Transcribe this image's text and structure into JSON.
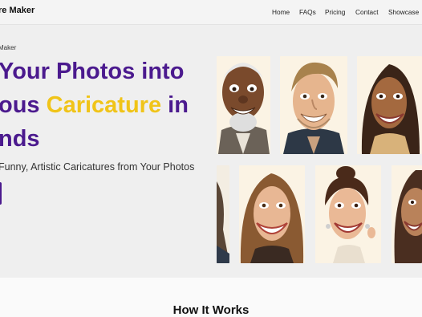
{
  "header": {
    "brand": "re Maker",
    "nav": [
      "Home",
      "FAQs",
      "Pricing",
      "Contact",
      "Showcase"
    ]
  },
  "hero": {
    "eyebrow": "Maker",
    "title_line1": "Your Photos into",
    "title_line2_pre": "ous ",
    "title_line2_accent": "Caricature",
    "title_line2_post": " in",
    "title_line3": "nds",
    "subtitle": "Funny, Artistic Caricatures from Your Photos"
  },
  "gallery": {
    "images": [
      "caricature-elderly-man",
      "caricature-smiling-man",
      "caricature-woman-long-hair",
      "caricature-partial-left",
      "caricature-woman-wavy-hair",
      "caricature-woman-updo-earrings",
      "caricature-partial-right"
    ]
  },
  "sections": {
    "how_it_works_title": "How It Works"
  },
  "colors": {
    "primary": "#4b1a8e",
    "accent": "#f0c419"
  }
}
